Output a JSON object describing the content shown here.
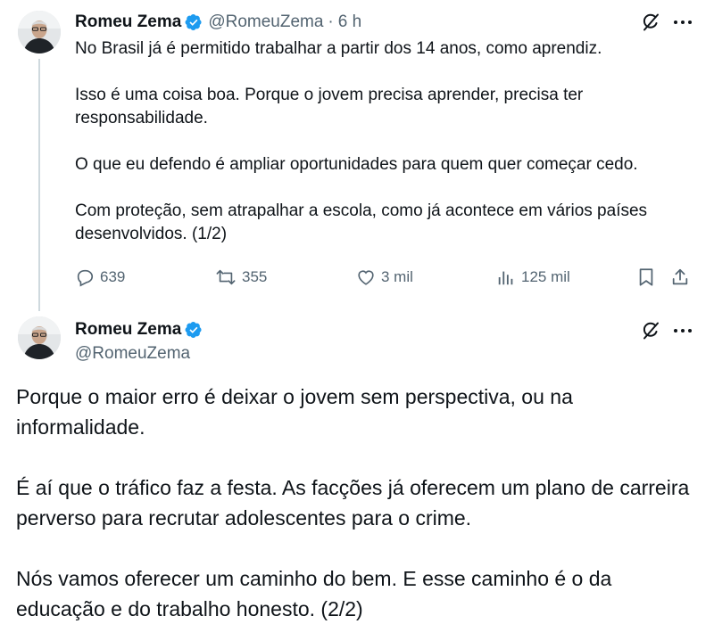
{
  "tweet1": {
    "author_name": "Romeu Zema",
    "handle": "@RomeuZema",
    "separator": "·",
    "time": "6 h",
    "paragraphs": [
      "No Brasil já é permitido trabalhar a partir dos 14 anos, como aprendiz.",
      "Isso é uma coisa boa. Porque o jovem precisa aprender, precisa ter responsabilidade.",
      "O que eu defendo é ampliar oportunidades para quem quer começar cedo.",
      "Com proteção, sem atrapalhar a escola, como já acontece em vários países desenvolvidos. (1/2)"
    ],
    "stats": {
      "replies": "639",
      "reposts": "355",
      "likes": "3 mil",
      "views": "125 mil"
    }
  },
  "tweet2": {
    "author_name": "Romeu Zema",
    "handle": "@RomeuZema",
    "paragraphs": [
      "Porque o maior erro é deixar o jovem sem perspectiva, ou na informalidade.",
      "É aí que o tráfico faz a festa. As facções já oferecem um plano de carreira perverso para recrutar adolescentes para o crime.",
      "Nós vamos oferecer um caminho do bem. E esse caminho é o da educação e do trabalho honesto. (2/2)"
    ]
  },
  "icons": {
    "verified": "verified-badge-icon",
    "grok": "grok-icon",
    "more": "more-icon",
    "reply": "reply-icon",
    "repost": "repost-icon",
    "like": "like-icon",
    "views": "views-icon",
    "bookmark": "bookmark-icon",
    "share": "share-icon"
  },
  "colors": {
    "text": "#0f1419",
    "muted": "#536471",
    "verified_blue": "#1d9bf0",
    "thread_line": "#cfd9de"
  }
}
